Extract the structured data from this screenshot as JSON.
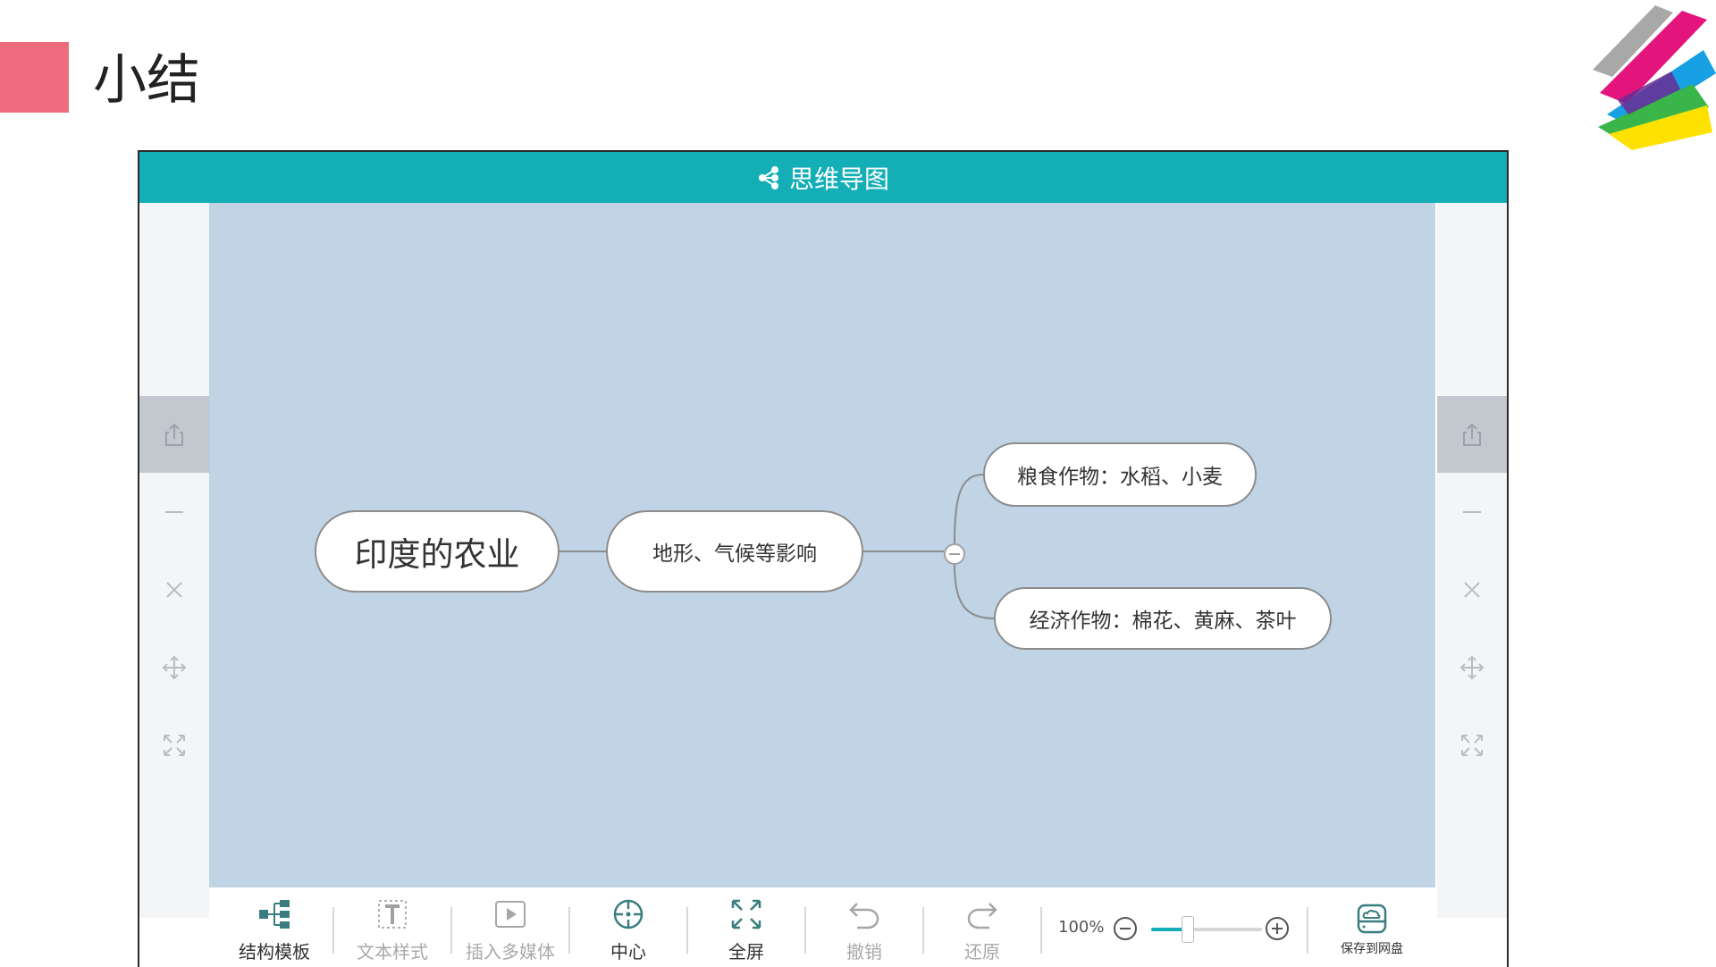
{
  "slide": {
    "title": "小结",
    "marker_color": "#ef6b7e"
  },
  "app": {
    "title": "思维导图",
    "accent_color": "#14aeb6",
    "canvas_color": "#c0d4e5"
  },
  "side_rail": {
    "items": [
      {
        "icon": "share-icon",
        "active": true
      },
      {
        "icon": "minus-icon",
        "active": false
      },
      {
        "icon": "close-icon",
        "active": false
      },
      {
        "icon": "move-icon",
        "active": false
      },
      {
        "icon": "expand-icon",
        "active": false
      }
    ]
  },
  "mindmap": {
    "root": "印度的农业",
    "branch": "地形、气候等影响",
    "leaves": [
      "粮食作物：水稻、小麦",
      "经济作物：棉花、黄麻、茶叶"
    ]
  },
  "toolbar": {
    "tools": [
      {
        "icon": "structure-template-icon",
        "label": "结构模板",
        "enabled": true
      },
      {
        "icon": "text-style-icon",
        "label": "文本样式",
        "enabled": false
      },
      {
        "icon": "insert-media-icon",
        "label": "插入多媒体",
        "enabled": false
      },
      {
        "icon": "center-icon",
        "label": "中心",
        "enabled": true
      },
      {
        "icon": "fullscreen-icon",
        "label": "全屏",
        "enabled": true
      },
      {
        "icon": "undo-icon",
        "label": "撤销",
        "enabled": false
      },
      {
        "icon": "redo-icon",
        "label": "还原",
        "enabled": false
      }
    ],
    "zoom": {
      "level_label": "100%",
      "slider_fraction": 0.33
    },
    "save": {
      "icon": "save-to-cloud-icon",
      "label": "保存到网盘"
    }
  }
}
